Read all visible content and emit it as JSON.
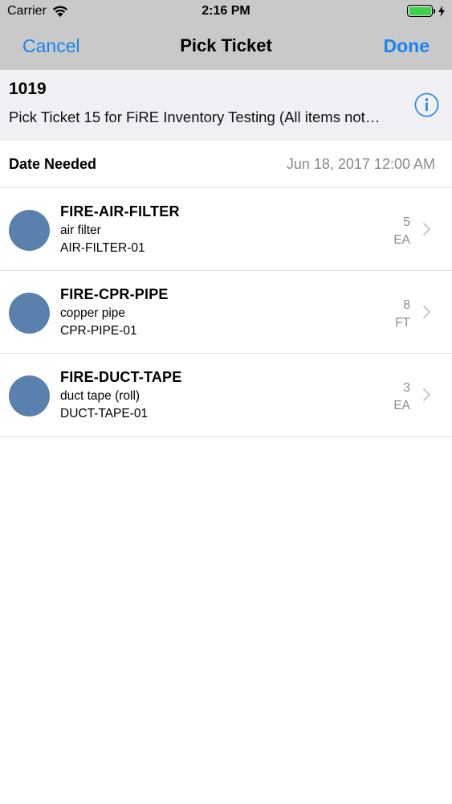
{
  "status_bar": {
    "carrier": "Carrier",
    "time": "2:16 PM",
    "battery_level": 1.0,
    "battery_color": "#37d34a"
  },
  "nav": {
    "cancel_label": "Cancel",
    "title": "Pick Ticket",
    "done_label": "Done",
    "tint_color": "#1a84f0"
  },
  "ticket": {
    "number": "1019",
    "description": "Pick Ticket 15 for FiRE Inventory Testing (All items not…",
    "info_icon": "info-circle-icon"
  },
  "date_needed": {
    "label": "Date Needed",
    "value": "Jun 18, 2017 12:00 AM"
  },
  "items": [
    {
      "code": "FIRE-AIR-FILTER",
      "name": "air filter",
      "sku": "AIR-FILTER-01",
      "qty": "5",
      "unit": "EA"
    },
    {
      "code": "FIRE-CPR-PIPE",
      "name": "copper pipe",
      "sku": "CPR-PIPE-01",
      "qty": "8",
      "unit": "FT"
    },
    {
      "code": "FIRE-DUCT-TAPE",
      "name": "duct tape (roll)",
      "sku": "DUCT-TAPE-01",
      "qty": "3",
      "unit": "EA"
    }
  ],
  "colors": {
    "bar_background": "#c9c9c9",
    "header_background": "#efeff4",
    "avatar": "#5a80ad",
    "secondary_text": "#8a8a8f"
  }
}
